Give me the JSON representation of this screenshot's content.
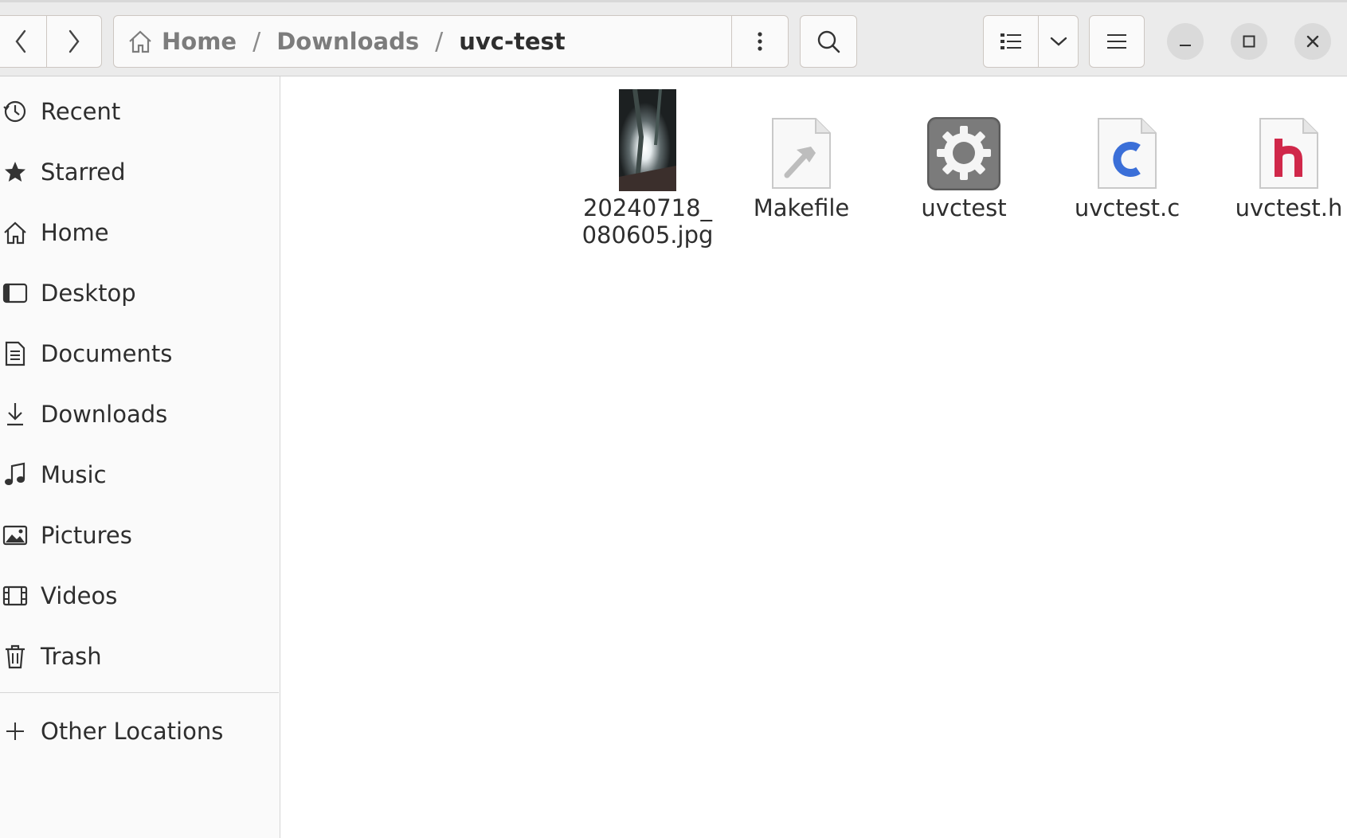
{
  "headerbar": {
    "path": [
      "Home",
      "Downloads",
      "uvc-test"
    ],
    "path_separator": "/"
  },
  "sidebar": {
    "items": [
      {
        "label": "Recent",
        "icon": "clock-icon"
      },
      {
        "label": "Starred",
        "icon": "star-icon"
      },
      {
        "label": "Home",
        "icon": "home-icon"
      },
      {
        "label": "Desktop",
        "icon": "desktop-icon"
      },
      {
        "label": "Documents",
        "icon": "document-icon"
      },
      {
        "label": "Downloads",
        "icon": "download-icon"
      },
      {
        "label": "Music",
        "icon": "music-icon"
      },
      {
        "label": "Pictures",
        "icon": "pictures-icon"
      },
      {
        "label": "Videos",
        "icon": "videos-icon"
      },
      {
        "label": "Trash",
        "icon": "trash-icon"
      }
    ],
    "other_locations": "Other Locations"
  },
  "files": [
    {
      "name_line1": "20240718_",
      "name_line2": "080605.jpg",
      "type": "image"
    },
    {
      "name": "Makefile",
      "type": "makefile"
    },
    {
      "name": "uvctest",
      "type": "executable"
    },
    {
      "name": "uvctest.c",
      "type": "c-source",
      "glyph": "c",
      "glyph_color": "#3b6fd8"
    },
    {
      "name": "uvctest.h",
      "type": "c-header",
      "glyph": "h",
      "glyph_color": "#d0284a"
    }
  ]
}
